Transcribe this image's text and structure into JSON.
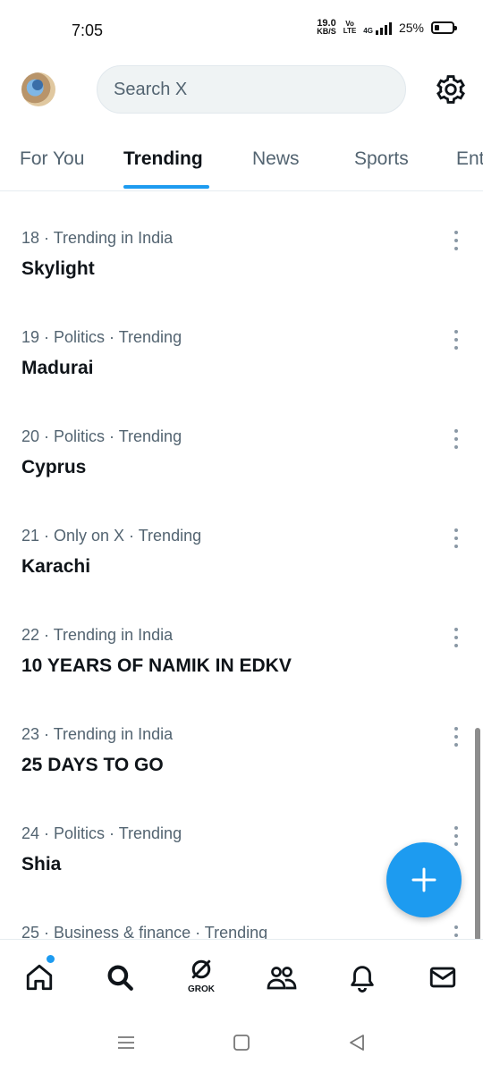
{
  "status_bar": {
    "time": "7:05",
    "net_speed_value": "19.0",
    "net_speed_unit": "KB/S",
    "volte_top": "Vo",
    "volte_bottom": "LTE",
    "network_label": "4G",
    "battery": "25%",
    "battery_level": 0.25
  },
  "header": {
    "avatar_icon": "profile-avatar",
    "search_placeholder": "Search X",
    "settings_icon": "gear-icon"
  },
  "tabs": [
    {
      "label": "For You",
      "active": false
    },
    {
      "label": "Trending",
      "active": true
    },
    {
      "label": "News",
      "active": false
    },
    {
      "label": "Sports",
      "active": false
    },
    {
      "label": "Ent",
      "active": false
    }
  ],
  "trends": [
    {
      "meta": "18 · Trending in India",
      "title": "Skylight"
    },
    {
      "meta": "19 · Politics · Trending",
      "title": "Madurai"
    },
    {
      "meta": "20 · Politics · Trending",
      "title": "Cyprus"
    },
    {
      "meta": "21 · Only on X · Trending",
      "title": "Karachi"
    },
    {
      "meta": "22 · Trending in India",
      "title": "10 YEARS OF NAMIK IN EDKV"
    },
    {
      "meta": "23 · Trending in India",
      "title": "25 DAYS TO GO"
    },
    {
      "meta": "24 · Politics · Trending",
      "title": "Shia"
    },
    {
      "meta": "25 · Business & finance · Trending",
      "title": ""
    }
  ],
  "fab": {
    "icon": "plus-icon"
  },
  "bottom_nav": {
    "items": [
      "home-icon",
      "search-icon",
      "grok-icon",
      "communities-icon",
      "bell-icon",
      "mail-icon"
    ],
    "grok_label": "GROK"
  },
  "colors": {
    "accent": "#1d9bf0",
    "text_primary": "#0f1419",
    "text_secondary": "#536471"
  }
}
